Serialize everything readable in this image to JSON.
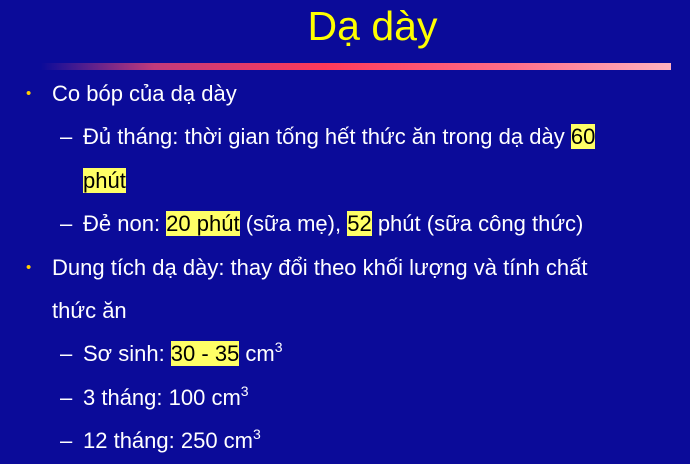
{
  "slide": {
    "title": "Dạ dày",
    "b1": {
      "bullet": "•",
      "text": "Co bóp của dạ dày",
      "s1": {
        "dash": "–",
        "text1": "Đủ tháng: thời gian tống hết thức ăn trong dạ dày ",
        "hl1": "60",
        "hl2": "phút"
      },
      "s2": {
        "dash": "–",
        "text1": "Đẻ non: ",
        "hl1": "20 phút",
        "text2": " (sữa mẹ), ",
        "hl2": "52",
        "text3": " phút (sữa công thức)"
      }
    },
    "b2": {
      "bullet": "•",
      "text1": "Dung tích dạ dày: thay đổi theo khối lượng và tính chất",
      "text2": "thức ăn",
      "s1": {
        "dash": "–",
        "text1": "Sơ sinh: ",
        "hl": "30 - 35",
        "unit": " cm",
        "sup": "3"
      },
      "s2": {
        "dash": "–",
        "text": "3 tháng: 100 cm",
        "sup": "3"
      },
      "s3": {
        "dash": "–",
        "text": "12 tháng: 250 cm",
        "sup": "3"
      }
    }
  },
  "colors": {
    "background": "#0b0b99",
    "title": "#ffff00",
    "text": "#ffffff",
    "bullet": "#ffcc00",
    "highlight": "#ffff66",
    "rule_start": "#0b0b99",
    "rule_end": "#ffb3bf"
  }
}
